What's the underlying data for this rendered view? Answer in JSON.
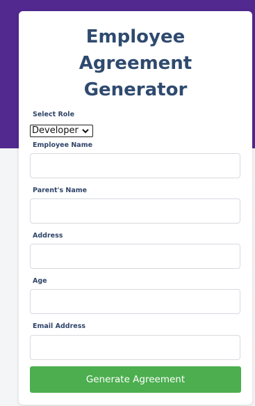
{
  "form": {
    "title_line1": "Employee",
    "title_line2": "Agreement",
    "title_line3": "Generator",
    "select_role_label": "Select Role",
    "selected_role": "Developer",
    "employee_name_label": "Employee Name",
    "employee_name_value": "",
    "parent_name_label": "Parent's Name",
    "parent_name_value": "",
    "address_label": "Address",
    "address_value": "",
    "age_label": "Age",
    "age_value": "",
    "email_label": "Email Address",
    "email_value": "",
    "submit_label": "Generate Agreement"
  },
  "colors": {
    "header_band": "#51298f",
    "title": "#2f4a6f",
    "button": "#4cae4f"
  },
  "icons": {
    "select_arrow": "chevron-down-icon"
  }
}
